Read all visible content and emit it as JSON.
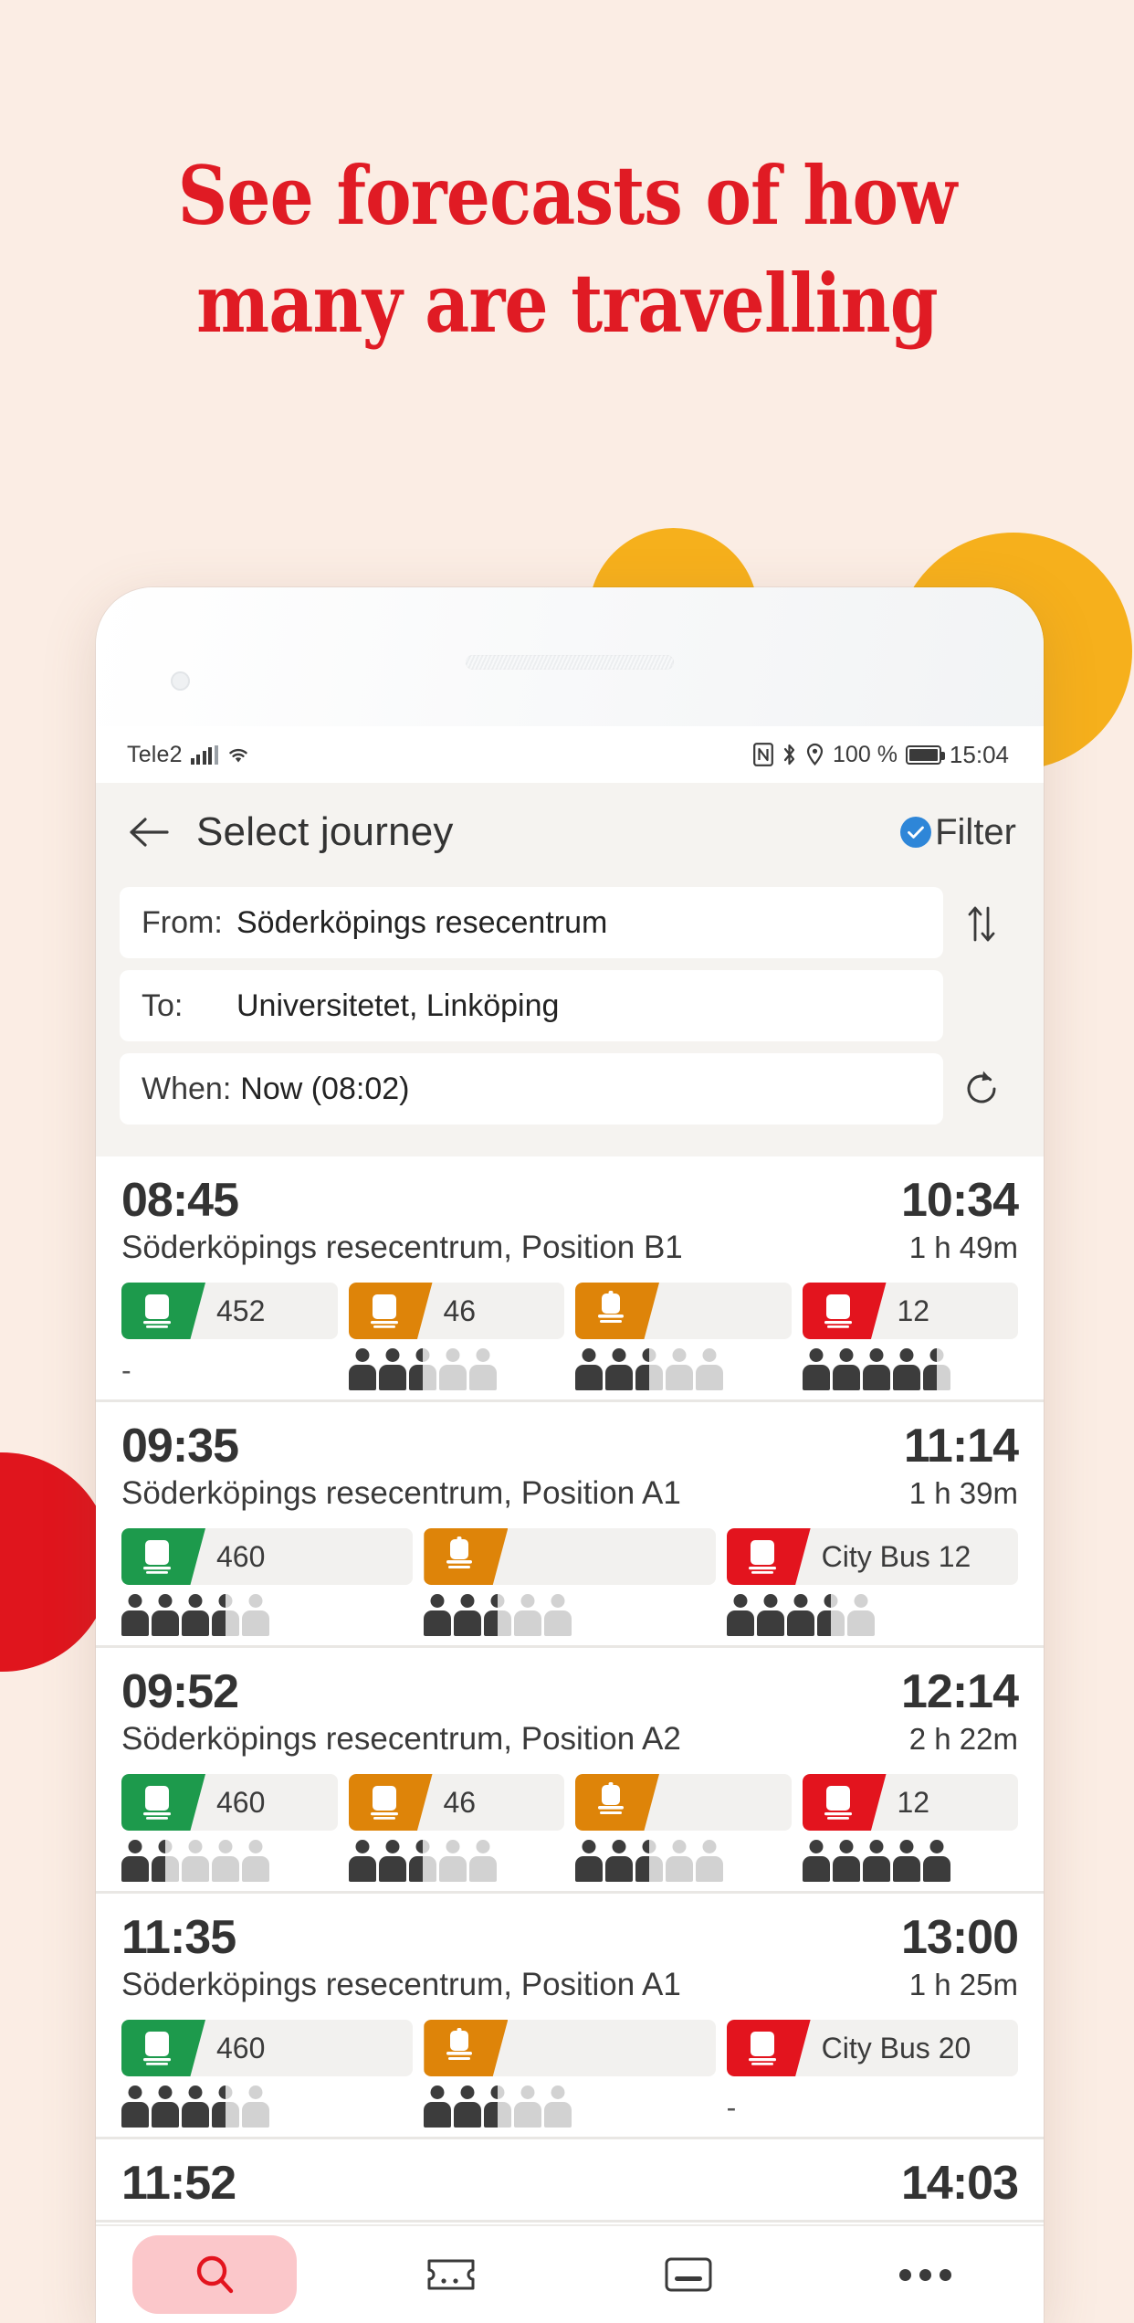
{
  "promo": {
    "headline_line1": "See forecasts of how",
    "headline_line2": "many are travelling",
    "headline_color": "#E01B24",
    "background_color": "#FBEDE4",
    "accent_yellow": "#F6B01C",
    "accent_red": "#E0151D"
  },
  "status_bar": {
    "carrier": "Tele2",
    "battery_percent": "100 %",
    "clock": "15:04",
    "icons": [
      "signal-icon",
      "wifi-icon",
      "nfc-icon",
      "bluetooth-icon",
      "location-icon",
      "battery-icon"
    ]
  },
  "header": {
    "back_label": "back-arrow",
    "title": "Select journey",
    "filter_label": "Filter",
    "filter_badge_color": "#2E86D8"
  },
  "search": {
    "from_label": "From:",
    "from_value": "Söderköpings resecentrum",
    "to_label": "To:",
    "to_value": "Universitetet, Linköping",
    "when_label": "When:",
    "when_value": "Now (08:02)",
    "swap_icon": "swap-vertical-icon",
    "refresh_icon": "refresh-icon"
  },
  "journeys": [
    {
      "departure": "08:45",
      "arrival": "10:34",
      "origin": "Söderköpings resecentrum, Position B1",
      "duration": "1 h 49m",
      "legs": [
        {
          "mode": "bus",
          "color": "green",
          "line": "452",
          "occupancy_filled": 0,
          "occupancy_total": 5,
          "occupancy_unknown": true
        },
        {
          "mode": "bus",
          "color": "orange",
          "line": "46",
          "occupancy_filled": 2,
          "occupancy_total": 5,
          "occupancy_unknown": false
        },
        {
          "mode": "train",
          "color": "orange",
          "line": "",
          "occupancy_filled": 2,
          "occupancy_total": 5,
          "occupancy_unknown": false
        },
        {
          "mode": "bus",
          "color": "red",
          "line": "12",
          "occupancy_filled": 4,
          "occupancy_total": 5,
          "occupancy_unknown": false
        }
      ]
    },
    {
      "departure": "09:35",
      "arrival": "11:14",
      "origin": "Söderköpings resecentrum, Position A1",
      "duration": "1 h 39m",
      "legs": [
        {
          "mode": "bus",
          "color": "green",
          "line": "460",
          "occupancy_filled": 3,
          "occupancy_total": 5,
          "occupancy_unknown": false
        },
        {
          "mode": "train",
          "color": "orange",
          "line": "",
          "occupancy_filled": 2,
          "occupancy_total": 5,
          "occupancy_unknown": false
        },
        {
          "mode": "bus",
          "color": "red",
          "line": "City Bus 12",
          "occupancy_filled": 3,
          "occupancy_total": 5,
          "occupancy_unknown": false
        }
      ]
    },
    {
      "departure": "09:52",
      "arrival": "12:14",
      "origin": "Söderköpings resecentrum, Position A2",
      "duration": "2 h 22m",
      "legs": [
        {
          "mode": "bus",
          "color": "green",
          "line": "460",
          "occupancy_filled": 1,
          "occupancy_total": 5,
          "occupancy_unknown": false
        },
        {
          "mode": "bus",
          "color": "orange",
          "line": "46",
          "occupancy_filled": 2,
          "occupancy_total": 5,
          "occupancy_unknown": false
        },
        {
          "mode": "train",
          "color": "orange",
          "line": "",
          "occupancy_filled": 2,
          "occupancy_total": 5,
          "occupancy_unknown": false
        },
        {
          "mode": "bus",
          "color": "red",
          "line": "12",
          "occupancy_filled": 5,
          "occupancy_total": 5,
          "occupancy_unknown": false
        }
      ]
    },
    {
      "departure": "11:35",
      "arrival": "13:00",
      "origin": "Söderköpings resecentrum, Position A1",
      "duration": "1 h 25m",
      "legs": [
        {
          "mode": "bus",
          "color": "green",
          "line": "460",
          "occupancy_filled": 3,
          "occupancy_total": 5,
          "occupancy_unknown": false
        },
        {
          "mode": "train",
          "color": "orange",
          "line": "",
          "occupancy_filled": 2,
          "occupancy_total": 5,
          "occupancy_unknown": false
        },
        {
          "mode": "bus",
          "color": "red",
          "line": "City Bus 20",
          "occupancy_filled": 0,
          "occupancy_total": 5,
          "occupancy_unknown": true
        }
      ]
    },
    {
      "departure": "11:52",
      "arrival": "14:03",
      "origin": "",
      "duration": "",
      "legs": []
    }
  ],
  "bottom_nav": {
    "items": [
      "search-icon",
      "ticket-icon",
      "card-icon",
      "more-icon"
    ],
    "active_index": 0,
    "active_pill_color": "#FBC7CA",
    "active_icon_color": "#E3141E"
  },
  "occupancy_none_label": "-"
}
